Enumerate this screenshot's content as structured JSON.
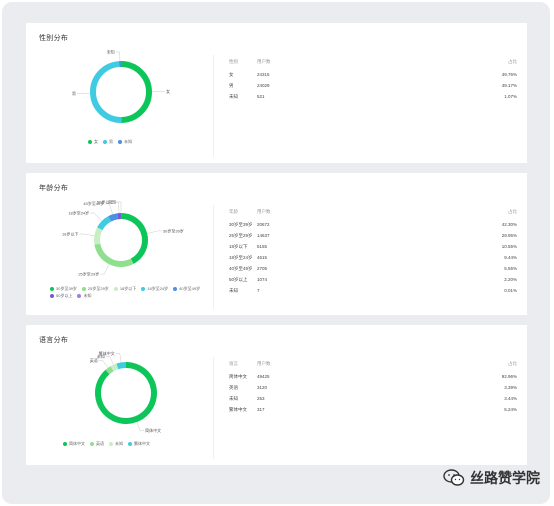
{
  "colors": {
    "green": "#0dc65a",
    "light_green": "#8ee08e",
    "pale_green": "#c8eec3",
    "cyan": "#3fcbe1",
    "blue": "#4e8fe6",
    "purple": "#6f5ad8",
    "frame_bg": "#ebecf0"
  },
  "gender": {
    "title": "性别分布",
    "headers": [
      "性别",
      "用户数",
      "占比"
    ],
    "rows": [
      {
        "label": "女",
        "users": "24315",
        "pct": "49.76%"
      },
      {
        "label": "男",
        "users": "24029",
        "pct": "49.17%"
      },
      {
        "label": "未知",
        "users": "521",
        "pct": "1.07%"
      }
    ],
    "slices": [
      {
        "label": "女",
        "value": 49.76,
        "color": "#0dc65a"
      },
      {
        "label": "男",
        "value": 49.17,
        "color": "#3fcbe1"
      },
      {
        "label": "未知",
        "value": 1.07,
        "color": "#4e8fe6"
      }
    ],
    "legend": [
      {
        "label": "女",
        "color": "#0dc65a"
      },
      {
        "label": "男",
        "color": "#3fcbe1"
      },
      {
        "label": "未知",
        "color": "#4e8fe6"
      }
    ]
  },
  "age": {
    "title": "年龄分布",
    "headers": [
      "年龄",
      "用户数",
      "占比"
    ],
    "rows": [
      {
        "label": "30岁至39岁",
        "users": "20672",
        "pct": "42.30%"
      },
      {
        "label": "25岁至29岁",
        "users": "14637",
        "pct": "29.95%"
      },
      {
        "label": "18岁以下",
        "users": "5155",
        "pct": "10.55%"
      },
      {
        "label": "18岁至24岁",
        "users": "4615",
        "pct": "9.44%"
      },
      {
        "label": "40岁至49岁",
        "users": "2705",
        "pct": "5.55%"
      },
      {
        "label": "50岁以上",
        "users": "1074",
        "pct": "2.20%"
      },
      {
        "label": "未知",
        "users": "7",
        "pct": "0.01%"
      }
    ],
    "slices": [
      {
        "label": "30岁至39岁",
        "value": 42.3,
        "color": "#0dc65a"
      },
      {
        "label": "25岁至29岁",
        "value": 29.95,
        "color": "#8ee08e"
      },
      {
        "label": "18岁以下",
        "value": 10.55,
        "color": "#c8eec3"
      },
      {
        "label": "18岁至24岁",
        "value": 9.44,
        "color": "#3fcbe1"
      },
      {
        "label": "40岁至49岁",
        "value": 5.55,
        "color": "#4e8fe6"
      },
      {
        "label": "50岁以上",
        "value": 2.2,
        "color": "#6f5ad8"
      },
      {
        "label": "未知",
        "value": 0.01,
        "color": "#9b7fe0"
      }
    ],
    "legend": [
      {
        "label": "30岁至39岁",
        "color": "#0dc65a"
      },
      {
        "label": "25岁至29岁",
        "color": "#8ee08e"
      },
      {
        "label": "18岁以下",
        "color": "#c8eec3"
      },
      {
        "label": "18岁至24岁",
        "color": "#3fcbe1"
      },
      {
        "label": "40岁至49岁",
        "color": "#4e8fe6"
      },
      {
        "label": "50岁以上",
        "color": "#6f5ad8"
      },
      {
        "label": "未知",
        "color": "#9b7fe0"
      }
    ]
  },
  "lang": {
    "title": "语言分布",
    "headers": [
      "语言",
      "用户数",
      "占比"
    ],
    "rows": [
      {
        "label": "简体中文",
        "users": "49425",
        "pct": "92.96%"
      },
      {
        "label": "英语",
        "users": "3120",
        "pct": "3.39%"
      },
      {
        "label": "未知",
        "users": "253",
        "pct": "3.44%"
      },
      {
        "label": "繁体中文",
        "users": "317",
        "pct": "5.24%"
      }
    ],
    "slices": [
      {
        "label": "简体中文",
        "value": 92.96,
        "color": "#0dc65a"
      },
      {
        "label": "英语",
        "value": 3.39,
        "color": "#8ee08e"
      },
      {
        "label": "未知",
        "value": 3.44,
        "color": "#c8eec3"
      },
      {
        "label": "繁体中文",
        "value": 5.24,
        "color": "#3fcbe1"
      }
    ],
    "legend": [
      {
        "label": "简体中文",
        "color": "#0dc65a"
      },
      {
        "label": "英语",
        "color": "#8ee08e"
      },
      {
        "label": "未知",
        "color": "#c8eec3"
      },
      {
        "label": "繁体中文",
        "color": "#3fcbe1"
      }
    ]
  },
  "watermark": {
    "text": "丝路赞学院",
    "icon": "wechat-icon"
  }
}
